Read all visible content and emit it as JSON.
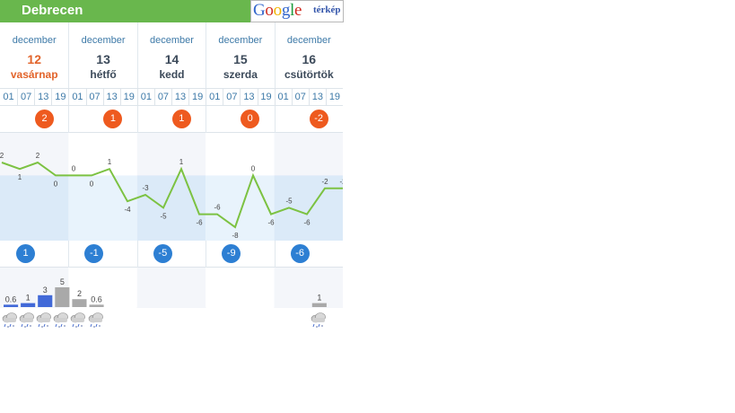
{
  "header": {
    "city": "Debrecen",
    "google_word": "Google",
    "map_link": "térkép"
  },
  "days": [
    {
      "month": "december",
      "day": "12",
      "weekday": "vasárnap",
      "today": true
    },
    {
      "month": "december",
      "day": "13",
      "weekday": "hétfő",
      "today": false
    },
    {
      "month": "december",
      "day": "14",
      "weekday": "kedd",
      "today": false
    },
    {
      "month": "december",
      "day": "15",
      "weekday": "szerda",
      "today": false
    },
    {
      "month": "december",
      "day": "16",
      "weekday": "csütörtök",
      "today": false
    }
  ],
  "hours": [
    "01",
    "07",
    "13",
    "19",
    "01",
    "07",
    "13",
    "19",
    "01",
    "07",
    "13",
    "19",
    "01",
    "07",
    "13",
    "19",
    "01",
    "07",
    "13",
    "19"
  ],
  "max_temps": [
    "2",
    "1",
    "1",
    "0",
    "-2"
  ],
  "min_temps": [
    "1",
    "-1",
    "-5",
    "-9",
    "-6"
  ],
  "colors": {
    "header": "#69b74d",
    "max_badge": "#ee5a1f",
    "min_badge": "#2d7fd3",
    "line": "#7cc242",
    "rain_bar": "#4169d8",
    "snow_bar": "#a9a9a9"
  },
  "chart_data": {
    "type": "line",
    "x": [
      "12/01",
      "12/07",
      "12/13",
      "12/19",
      "13/01",
      "13/07",
      "13/13",
      "13/19",
      "14/01",
      "14/07",
      "14/13",
      "14/19",
      "15/01",
      "15/07",
      "15/13",
      "15/19",
      "16/01",
      "16/07",
      "16/13",
      "16/19"
    ],
    "series": [
      {
        "values": [
          2,
          1,
          2,
          0,
          0,
          0,
          1,
          -4,
          -3,
          -5,
          1,
          -6,
          -6,
          -8,
          0,
          -6,
          -5,
          -6,
          -2,
          -2
        ]
      }
    ],
    "ylim": [
      -8,
      2
    ]
  },
  "precip_data": {
    "type": "bar",
    "values": [
      0.6,
      1,
      3,
      5,
      2,
      0.6,
      1
    ],
    "labels": [
      "0.6",
      "1",
      "3",
      "5",
      "2",
      "0.6",
      "1"
    ],
    "kinds": [
      "rain",
      "rain",
      "rain",
      "snow",
      "snow",
      "snow",
      "snow"
    ]
  },
  "icons": [
    "cloud-rain-snow-icon",
    "cloud-rain-snow-icon",
    "cloud-rain-snow-icon",
    "cloud-rain-snow-icon",
    "cloud-rain-snow-icon",
    "cloud-rain-snow-icon",
    "cloud-rain-snow-icon"
  ]
}
